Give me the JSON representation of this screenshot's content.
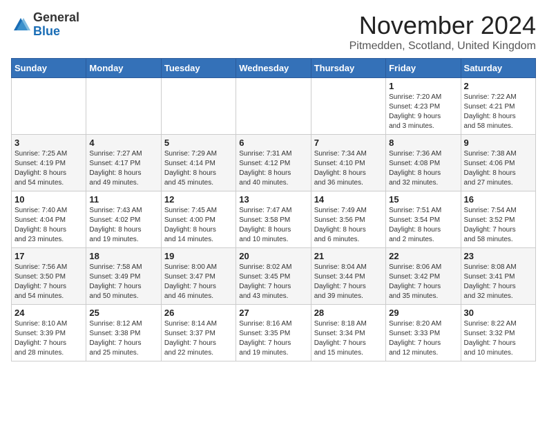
{
  "header": {
    "logo_general": "General",
    "logo_blue": "Blue",
    "month_title": "November 2024",
    "location": "Pitmedden, Scotland, United Kingdom"
  },
  "days_of_week": [
    "Sunday",
    "Monday",
    "Tuesday",
    "Wednesday",
    "Thursday",
    "Friday",
    "Saturday"
  ],
  "weeks": [
    [
      {
        "num": "",
        "detail": ""
      },
      {
        "num": "",
        "detail": ""
      },
      {
        "num": "",
        "detail": ""
      },
      {
        "num": "",
        "detail": ""
      },
      {
        "num": "",
        "detail": ""
      },
      {
        "num": "1",
        "detail": "Sunrise: 7:20 AM\nSunset: 4:23 PM\nDaylight: 9 hours\nand 3 minutes."
      },
      {
        "num": "2",
        "detail": "Sunrise: 7:22 AM\nSunset: 4:21 PM\nDaylight: 8 hours\nand 58 minutes."
      }
    ],
    [
      {
        "num": "3",
        "detail": "Sunrise: 7:25 AM\nSunset: 4:19 PM\nDaylight: 8 hours\nand 54 minutes."
      },
      {
        "num": "4",
        "detail": "Sunrise: 7:27 AM\nSunset: 4:17 PM\nDaylight: 8 hours\nand 49 minutes."
      },
      {
        "num": "5",
        "detail": "Sunrise: 7:29 AM\nSunset: 4:14 PM\nDaylight: 8 hours\nand 45 minutes."
      },
      {
        "num": "6",
        "detail": "Sunrise: 7:31 AM\nSunset: 4:12 PM\nDaylight: 8 hours\nand 40 minutes."
      },
      {
        "num": "7",
        "detail": "Sunrise: 7:34 AM\nSunset: 4:10 PM\nDaylight: 8 hours\nand 36 minutes."
      },
      {
        "num": "8",
        "detail": "Sunrise: 7:36 AM\nSunset: 4:08 PM\nDaylight: 8 hours\nand 32 minutes."
      },
      {
        "num": "9",
        "detail": "Sunrise: 7:38 AM\nSunset: 4:06 PM\nDaylight: 8 hours\nand 27 minutes."
      }
    ],
    [
      {
        "num": "10",
        "detail": "Sunrise: 7:40 AM\nSunset: 4:04 PM\nDaylight: 8 hours\nand 23 minutes."
      },
      {
        "num": "11",
        "detail": "Sunrise: 7:43 AM\nSunset: 4:02 PM\nDaylight: 8 hours\nand 19 minutes."
      },
      {
        "num": "12",
        "detail": "Sunrise: 7:45 AM\nSunset: 4:00 PM\nDaylight: 8 hours\nand 14 minutes."
      },
      {
        "num": "13",
        "detail": "Sunrise: 7:47 AM\nSunset: 3:58 PM\nDaylight: 8 hours\nand 10 minutes."
      },
      {
        "num": "14",
        "detail": "Sunrise: 7:49 AM\nSunset: 3:56 PM\nDaylight: 8 hours\nand 6 minutes."
      },
      {
        "num": "15",
        "detail": "Sunrise: 7:51 AM\nSunset: 3:54 PM\nDaylight: 8 hours\nand 2 minutes."
      },
      {
        "num": "16",
        "detail": "Sunrise: 7:54 AM\nSunset: 3:52 PM\nDaylight: 7 hours\nand 58 minutes."
      }
    ],
    [
      {
        "num": "17",
        "detail": "Sunrise: 7:56 AM\nSunset: 3:50 PM\nDaylight: 7 hours\nand 54 minutes."
      },
      {
        "num": "18",
        "detail": "Sunrise: 7:58 AM\nSunset: 3:49 PM\nDaylight: 7 hours\nand 50 minutes."
      },
      {
        "num": "19",
        "detail": "Sunrise: 8:00 AM\nSunset: 3:47 PM\nDaylight: 7 hours\nand 46 minutes."
      },
      {
        "num": "20",
        "detail": "Sunrise: 8:02 AM\nSunset: 3:45 PM\nDaylight: 7 hours\nand 43 minutes."
      },
      {
        "num": "21",
        "detail": "Sunrise: 8:04 AM\nSunset: 3:44 PM\nDaylight: 7 hours\nand 39 minutes."
      },
      {
        "num": "22",
        "detail": "Sunrise: 8:06 AM\nSunset: 3:42 PM\nDaylight: 7 hours\nand 35 minutes."
      },
      {
        "num": "23",
        "detail": "Sunrise: 8:08 AM\nSunset: 3:41 PM\nDaylight: 7 hours\nand 32 minutes."
      }
    ],
    [
      {
        "num": "24",
        "detail": "Sunrise: 8:10 AM\nSunset: 3:39 PM\nDaylight: 7 hours\nand 28 minutes."
      },
      {
        "num": "25",
        "detail": "Sunrise: 8:12 AM\nSunset: 3:38 PM\nDaylight: 7 hours\nand 25 minutes."
      },
      {
        "num": "26",
        "detail": "Sunrise: 8:14 AM\nSunset: 3:37 PM\nDaylight: 7 hours\nand 22 minutes."
      },
      {
        "num": "27",
        "detail": "Sunrise: 8:16 AM\nSunset: 3:35 PM\nDaylight: 7 hours\nand 19 minutes."
      },
      {
        "num": "28",
        "detail": "Sunrise: 8:18 AM\nSunset: 3:34 PM\nDaylight: 7 hours\nand 15 minutes."
      },
      {
        "num": "29",
        "detail": "Sunrise: 8:20 AM\nSunset: 3:33 PM\nDaylight: 7 hours\nand 12 minutes."
      },
      {
        "num": "30",
        "detail": "Sunrise: 8:22 AM\nSunset: 3:32 PM\nDaylight: 7 hours\nand 10 minutes."
      }
    ]
  ]
}
